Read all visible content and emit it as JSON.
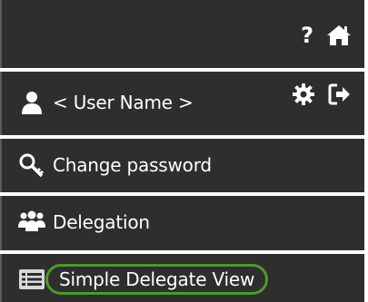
{
  "header": {
    "help_symbol": "?",
    "home_icon": "home-icon"
  },
  "user": {
    "name_placeholder": "< User Name >",
    "user_icon": "user-icon",
    "settings_icon": "gear-icon",
    "logout_icon": "logout-icon"
  },
  "menu": {
    "items": [
      {
        "label": "Change password",
        "icon": "key-icon"
      },
      {
        "label": "Delegation",
        "icon": "people-icon"
      },
      {
        "label": "Simple Delegate View",
        "icon": "list-icon",
        "highlighted": true
      }
    ]
  },
  "colors": {
    "bar_background": "#2e2e2e",
    "text": "#ffffff",
    "highlight_outline": "#4c9a2a"
  }
}
